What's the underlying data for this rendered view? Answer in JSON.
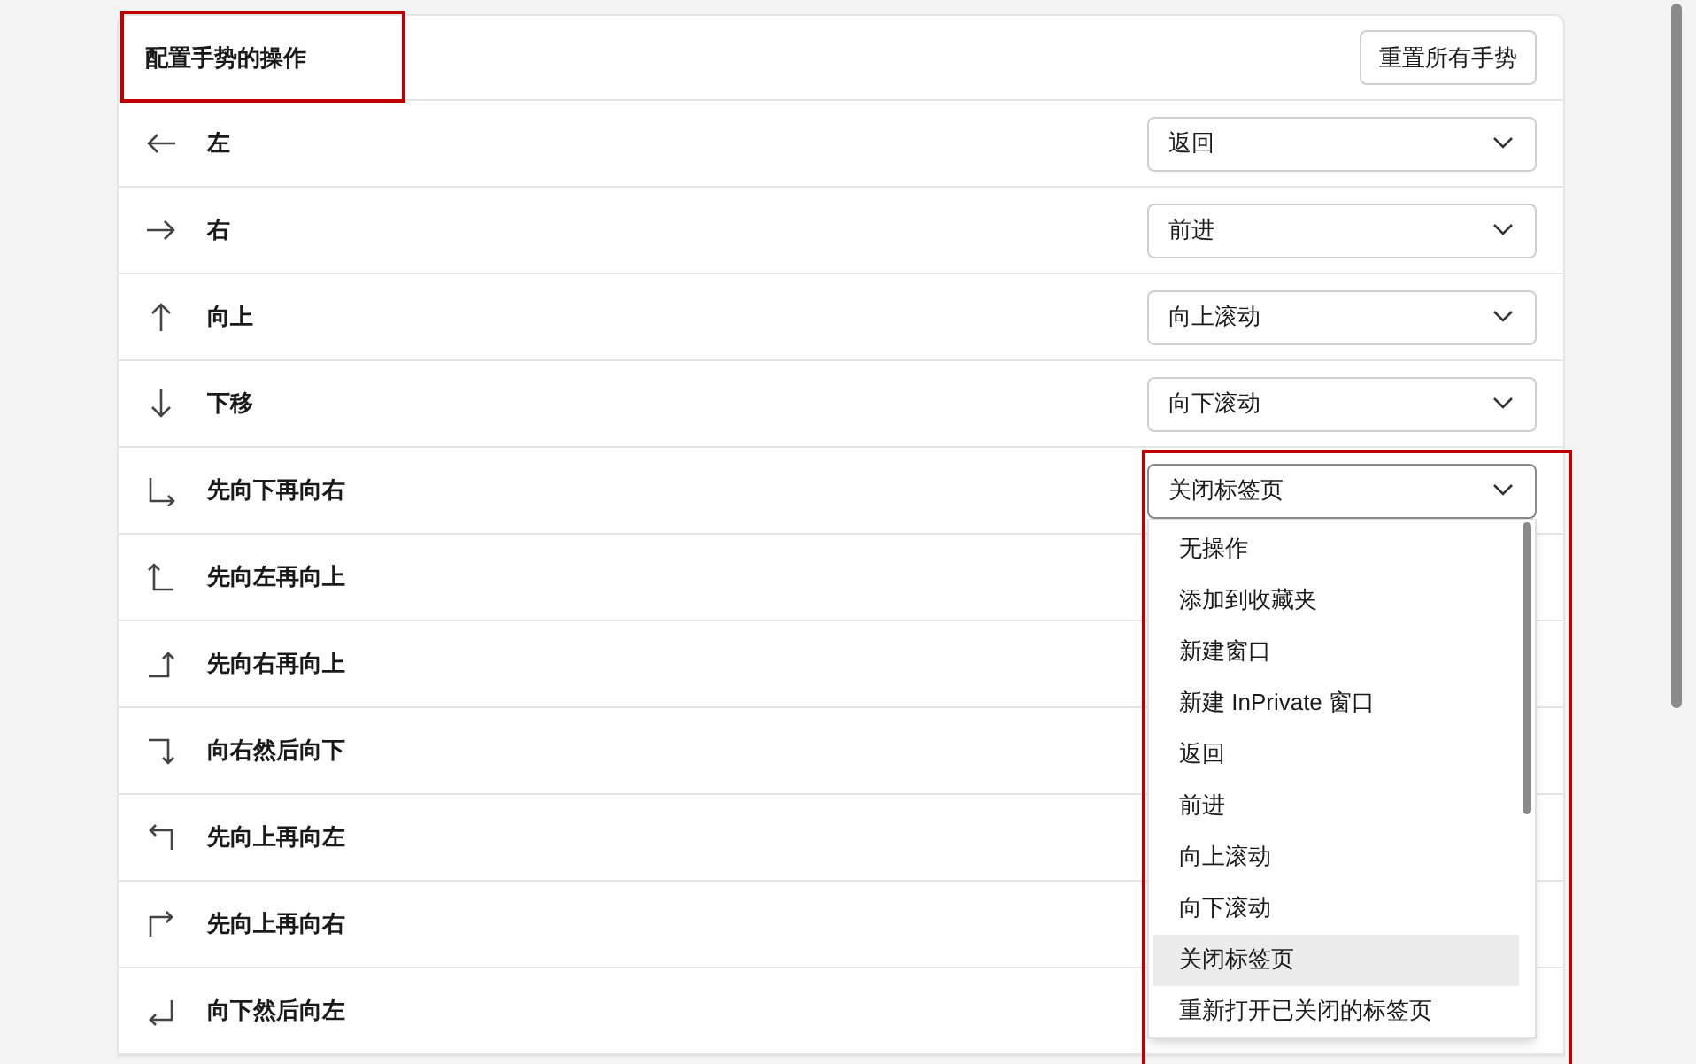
{
  "section": {
    "title": "配置手势的操作",
    "reset_button": "重置所有手势"
  },
  "rows": [
    {
      "label": "左",
      "value": "返回",
      "expanded": false
    },
    {
      "label": "右",
      "value": "前进",
      "expanded": false
    },
    {
      "label": "向上",
      "value": "向上滚动",
      "expanded": false
    },
    {
      "label": "下移",
      "value": "向下滚动",
      "expanded": false
    },
    {
      "label": "先向下再向右",
      "value": "关闭标签页",
      "expanded": true
    },
    {
      "label": "先向左再向上"
    },
    {
      "label": "先向右再向上"
    },
    {
      "label": "向右然后向下"
    },
    {
      "label": "先向上再向左"
    },
    {
      "label": "先向上再向右"
    },
    {
      "label": "向下然后向左"
    }
  ],
  "dropdown_options": [
    {
      "label": "无操作",
      "selected": false
    },
    {
      "label": "添加到收藏夹",
      "selected": false
    },
    {
      "label": "新建窗口",
      "selected": false
    },
    {
      "label": "新建 InPrivate 窗口",
      "selected": false
    },
    {
      "label": "返回",
      "selected": false
    },
    {
      "label": "前进",
      "selected": false
    },
    {
      "label": "向上滚动",
      "selected": false
    },
    {
      "label": "向下滚动",
      "selected": false
    },
    {
      "label": "关闭标签页",
      "selected": true
    },
    {
      "label": "重新打开已关闭的标签页",
      "selected": false
    }
  ],
  "annotations": [
    {
      "kind": "highlight-box"
    },
    {
      "kind": "highlight-box"
    }
  ]
}
